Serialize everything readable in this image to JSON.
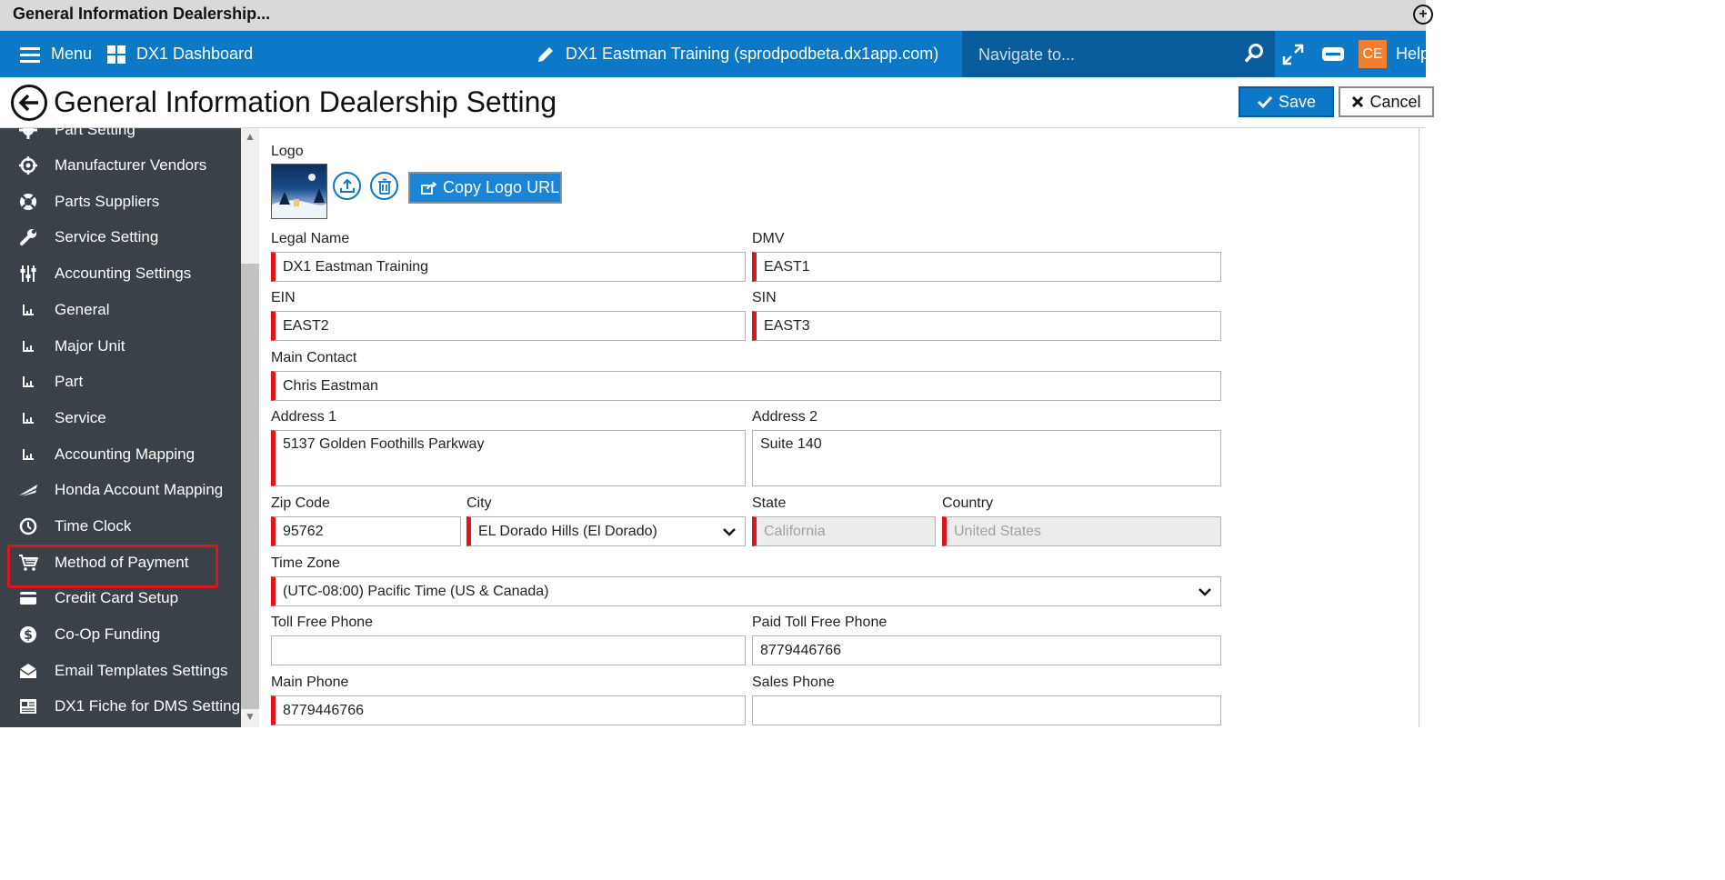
{
  "window": {
    "title": "General Information Dealership..."
  },
  "topbar": {
    "menu_label": "Menu",
    "dashboard_label": "DX1 Dashboard",
    "dealership_label": "DX1 Eastman Training (sprodpodbeta.dx1app.com)",
    "navigate_placeholder": "Navigate to...",
    "user_initials": "CE",
    "help_label": "Help"
  },
  "page": {
    "title": "General Information Dealership Setting",
    "save_label": "Save",
    "cancel_label": "Cancel"
  },
  "sidebar": {
    "items": [
      {
        "label": "Part Setting",
        "icon": "gear-icon"
      },
      {
        "label": "Manufacturer Vendors",
        "icon": "crosshair-icon"
      },
      {
        "label": "Parts Suppliers",
        "icon": "lifebuoy-icon"
      },
      {
        "label": "Service Setting",
        "icon": "wrench-icon"
      },
      {
        "label": "Accounting Settings",
        "icon": "sliders-icon"
      },
      {
        "label": "General",
        "icon": "small-chart-icon"
      },
      {
        "label": "Major Unit",
        "icon": "small-chart-icon"
      },
      {
        "label": "Part",
        "icon": "small-chart-icon"
      },
      {
        "label": "Service",
        "icon": "small-chart-icon"
      },
      {
        "label": "Accounting Mapping",
        "icon": "small-chart-icon"
      },
      {
        "label": "Honda Account Mapping",
        "icon": "honda-wing-icon"
      },
      {
        "label": "Time Clock",
        "icon": "clock-icon"
      },
      {
        "label": "Method of Payment",
        "icon": "cart-icon"
      },
      {
        "label": "Credit Card Setup",
        "icon": "credit-card-icon"
      },
      {
        "label": "Co-Op Funding",
        "icon": "dollar-icon"
      },
      {
        "label": "Email Templates Settings",
        "icon": "envelope-icon"
      },
      {
        "label": "DX1 Fiche for DMS Setting",
        "icon": "newspaper-icon"
      }
    ]
  },
  "form": {
    "logo_label": "Logo",
    "copy_logo_label": "Copy Logo URL",
    "legal_name": {
      "label": "Legal Name",
      "value": "DX1 Eastman Training"
    },
    "dmv": {
      "label": "DMV",
      "value": "EAST1"
    },
    "ein": {
      "label": "EIN",
      "value": "EAST2"
    },
    "sin": {
      "label": "SIN",
      "value": "EAST3"
    },
    "main_contact": {
      "label": "Main Contact",
      "value": "Chris Eastman"
    },
    "address1": {
      "label": "Address 1",
      "value": "5137 Golden Foothills Parkway"
    },
    "address2": {
      "label": "Address 2",
      "value": "Suite 140"
    },
    "zip": {
      "label": "Zip Code",
      "value": "95762"
    },
    "city": {
      "label": "City",
      "value": "EL Dorado Hills (El Dorado)"
    },
    "state": {
      "label": "State",
      "value": "California"
    },
    "country": {
      "label": "Country",
      "value": "United States"
    },
    "time_zone": {
      "label": "Time Zone",
      "value": "(UTC-08:00) Pacific Time (US & Canada)"
    },
    "toll_free": {
      "label": "Toll Free Phone",
      "value": ""
    },
    "paid_toll_free": {
      "label": "Paid Toll Free Phone",
      "value": "8779446766"
    },
    "main_phone": {
      "label": "Main Phone",
      "value": "8779446766"
    },
    "sales_phone": {
      "label": "Sales Phone",
      "value": ""
    }
  },
  "colors": {
    "brand_blue": "#0e78c8",
    "required_red": "#e0141b",
    "sidebar_bg": "#3a4148",
    "user_badge": "#f07f2f"
  }
}
